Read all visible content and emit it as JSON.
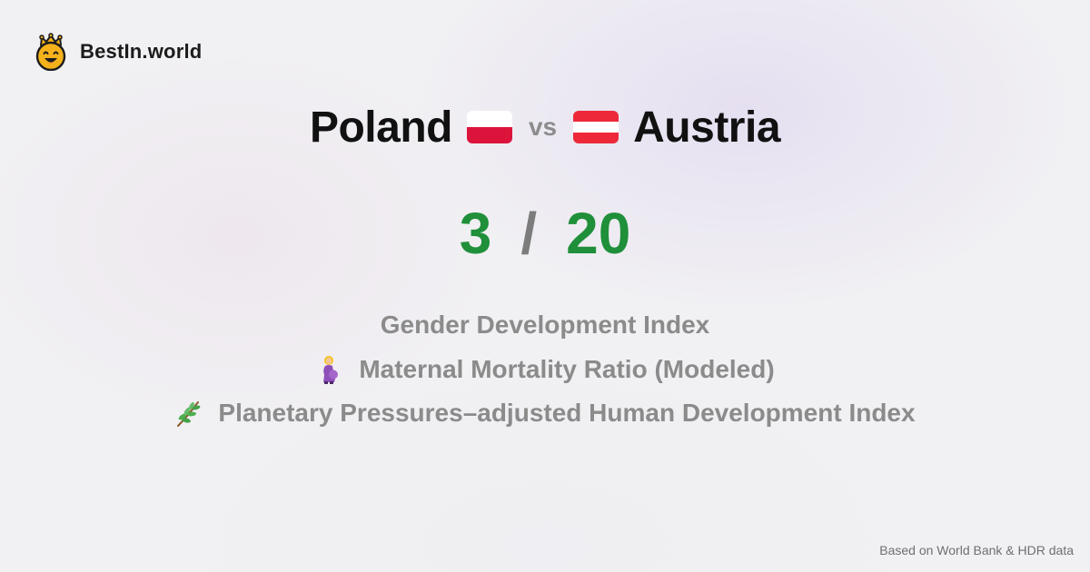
{
  "brand": {
    "name": "BestIn.world",
    "logo_icon": "crowned-smiley-icon"
  },
  "comparison": {
    "left_country": "Poland",
    "left_flag": {
      "icon": "poland-flag-icon",
      "colors": [
        "#ffffff",
        "#dc143c"
      ]
    },
    "vs_label": "vs",
    "right_country": "Austria",
    "right_flag": {
      "icon": "austria-flag-icon",
      "colors": [
        "#ed2939",
        "#ffffff",
        "#ed2939"
      ]
    }
  },
  "score": {
    "left": "3",
    "separator": "/",
    "right": "20",
    "color": "#1f8f3a"
  },
  "metrics": [
    {
      "label": "Gender Development Index",
      "icon": ""
    },
    {
      "label": "Maternal Mortality Ratio (Modeled)",
      "icon": "pregnant-woman-icon"
    },
    {
      "label": "Planetary Pressures–adjusted Human Development Index",
      "icon": "herb-icon"
    }
  ],
  "footer": {
    "source": "Based on World Bank & HDR data"
  }
}
